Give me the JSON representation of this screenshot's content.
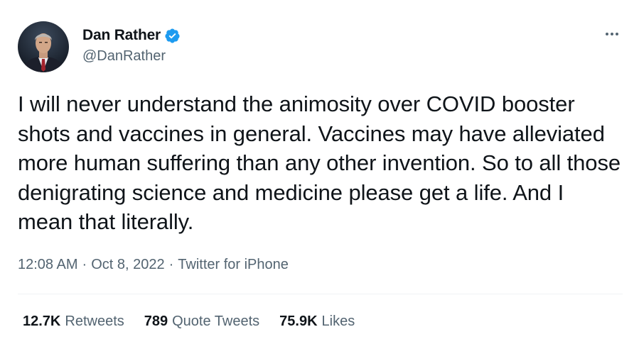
{
  "author": {
    "display_name": "Dan Rather",
    "handle": "@DanRather",
    "verified": true,
    "avatar_icon": "profile-photo"
  },
  "tweet": {
    "text": "I will never understand the animosity over COVID booster shots and vaccines in general. Vaccines may have alleviated more human suffering than any other invention. So to all those denigrating science and medicine please get a life. And I mean that literally.",
    "time": "12:08 AM",
    "date": "Oct 8, 2022",
    "source": "Twitter for iPhone",
    "separator": "·"
  },
  "stats": {
    "retweets_count": "12.7K",
    "retweets_label": "Retweets",
    "quote_count": "789",
    "quote_label": "Quote Tweets",
    "likes_count": "75.9K",
    "likes_label": "Likes"
  },
  "colors": {
    "verified_blue": "#1d9bf0",
    "text_primary": "#0f1419",
    "text_secondary": "#536471"
  }
}
